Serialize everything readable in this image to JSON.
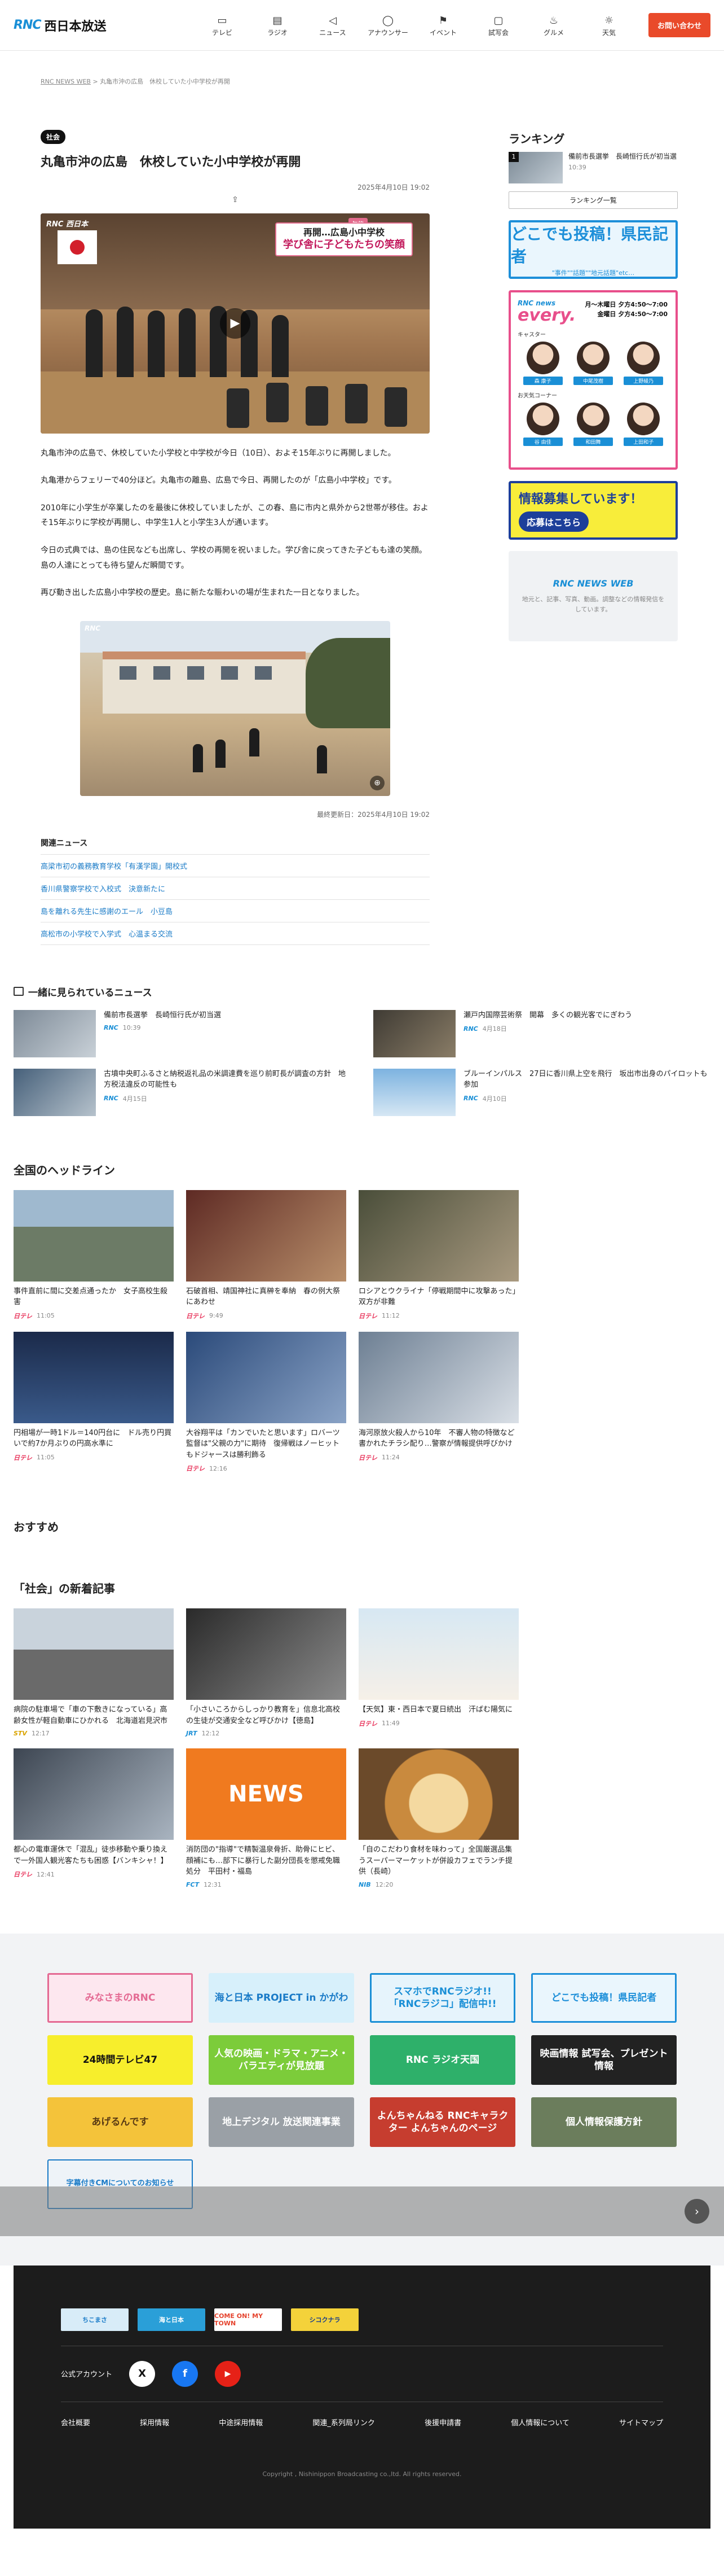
{
  "header": {
    "logo_mark": "RNC",
    "logo_text": "西日本放送",
    "nav": [
      {
        "icon": "tv-icon",
        "glyph": "▭",
        "label": "テレビ"
      },
      {
        "icon": "radio-icon",
        "glyph": "▤",
        "label": "ラジオ"
      },
      {
        "icon": "megaphone-icon",
        "glyph": "◁",
        "label": "ニュース"
      },
      {
        "icon": "person-icon",
        "glyph": "◯",
        "label": "アナウンサー"
      },
      {
        "icon": "flag-icon",
        "glyph": "⚑",
        "label": "イベント"
      },
      {
        "icon": "frame-icon",
        "glyph": "▢",
        "label": "試写会"
      },
      {
        "icon": "food-icon",
        "glyph": "♨",
        "label": "グルメ"
      },
      {
        "icon": "weather-icon",
        "glyph": "☼",
        "label": "天気"
      }
    ],
    "cta": "お問い合わせ"
  },
  "breadcrumb": {
    "home": "RNC NEWS WEB",
    "sep": ">",
    "current": "丸亀市沖の広島　休校していた小中学校が再開"
  },
  "article": {
    "tag": "社会",
    "title": "丸亀市沖の広島　休校していた小中学校が再開",
    "date": "2025年4月10日 19:02",
    "share_glyph": "⇪",
    "video": {
      "logo": "RNC 西日本",
      "badge": "午後",
      "telop_line1": "再開…広島小中学校",
      "telop_line2": "学び舎に子どもたちの笑顔",
      "play_glyph": "▶"
    },
    "paragraphs": [
      "丸亀市沖の広島で、休校していた小学校と中学校が今日（10日）、およそ15年ぶりに再開しました。",
      "丸亀港からフェリーで40分ほど。丸亀市の離島、広島で今日、再開したのが「広島小中学校」です。",
      "2010年に小学生が卒業したのを最後に休校していましたが、この春、島に市内と県外から2世帯が移住。およそ15年ぶりに学校が再開し、中学生1人と小学生3人が通います。",
      "今日の式典では、島の住民なども出席し、学校の再開を祝いました。学び舎に戻ってきた子どもも達の笑顔。島の人達にとっても待ち望んだ瞬間です。",
      "再び動き出した広島小中学校の歴史。島に新たな賑わいの場が生まれた一日となりました。"
    ],
    "photo_logo": "RNC",
    "zoom_glyph": "⊕",
    "updated": "最終更新日：2025年4月10日 19:02",
    "related_heading": "関連ニュース",
    "related": [
      "高梁市初の義務教育学校「有漢学園」開校式",
      "香川県警察学校で入校式　決意新たに",
      "島を離れる先生に感謝のエール　小豆島",
      "高松市の小学校で入学式　心温まる交流"
    ]
  },
  "sidebar": {
    "ranking_heading": "ランキング",
    "ranking": [
      {
        "num": "1",
        "title": "備前市長選挙　長崎恒行氏が初当選",
        "time": "10:39"
      }
    ],
    "ranking_button": "ランキング一覧",
    "banner_reporter": {
      "title": "どこでも投稿！県民記者",
      "sub": "\"事件\"\"話題\"\"地元話題\"etc…"
    },
    "banner_every": {
      "brand": "RNC news",
      "name": "every.",
      "times": [
        "月〜木曜日 夕方4:50〜7:00",
        "金曜日 夕方4:50〜7:00"
      ],
      "caster_label": "キャスター",
      "weather_label": "お天気コーナー",
      "casters": [
        "森 康子",
        "中尾茂樹",
        "上野綾乃"
      ],
      "weather": [
        "谷 由佳",
        "和田舞",
        "上田和子"
      ]
    },
    "banner_info": {
      "title": "情報募集しています！",
      "button": "応募はこちら"
    },
    "banner_ad": {
      "brand": "RNC NEWS WEB",
      "text": "地元と、記事、写真、動画。調整などの情報発信をしています。"
    }
  },
  "together": {
    "heading": "一緒に見られているニュース",
    "items": [
      {
        "title": "備前市長選挙　長崎恒行氏が初当選",
        "source": "RNC",
        "time": "10:39"
      },
      {
        "title": "瀬戸内国際芸術祭　開幕　多くの観光客でにぎわう",
        "source": "RNC",
        "time": "4月18日"
      },
      {
        "title": "古墳中央町ふるさと納税返礼品の米調達費を巡り前町長が調査の方針　地方税法違反の可能性も",
        "source": "RNC",
        "time": "4月15日"
      },
      {
        "title": "ブルーインパルス　27日に香川県上空を飛行　坂出市出身のパイロットも参加",
        "source": "RNC",
        "time": "4月10日"
      }
    ]
  },
  "national": {
    "heading": "全国のヘッドライン",
    "items": [
      {
        "title": "事件直前に間に交差点通ったか　女子高校生殺害",
        "source": "日テレ",
        "time": "11:05"
      },
      {
        "title": "石破首相、靖国神社に真榊を奉納　春の例大祭にあわせ",
        "source": "日テレ",
        "time": "9:49"
      },
      {
        "title": "ロシアとウクライナ「停戦期間中に攻撃あった」双方が非難",
        "source": "日テレ",
        "time": "11:12"
      },
      {
        "title": "円相場が一時1ドル＝140円台に　ドル売り円買いで約7か月ぶりの円高水準に",
        "source": "日テレ",
        "time": "11:05"
      },
      {
        "title": "大谷翔平は「カンでいたと思います」ロバーツ監督は\"父親の力\"に期待　復帰戦はノーヒットもドジャースは勝利飾る",
        "source": "日テレ",
        "time": "12:16"
      },
      {
        "title": "海河原放火殺人から10年　不審人物の特徴など書かれたチラシ配り…警察が情報提供呼びかけ",
        "source": "日テレ",
        "time": "11:24"
      }
    ]
  },
  "recommend": {
    "heading": "おすすめ"
  },
  "social": {
    "heading": "「社会」の新着記事",
    "items": [
      {
        "title": "病院の駐車場で「車の下敷きになっている」高齢女性が軽自動車にひかれる　北海道岩見沢市",
        "source": "STV",
        "time": "12:17"
      },
      {
        "title": "「小さいころからしっかり教育を」信息北高校の生徒が交通安全など呼びかけ【徳島】",
        "source": "JRT",
        "time": "12:12"
      },
      {
        "title": "【天気】東・西日本で夏日続出　汗ばむ陽気に",
        "source": "日テレ",
        "time": "11:49"
      },
      {
        "title": "都心の電車運休で「混乱」徒歩移動や乗り換えで一外国人観光客たちも困惑【バンキシャ！】",
        "source": "日テレ",
        "time": "12:41"
      },
      {
        "title": "消防団の\"指導\"で精製温泉骨折、助骨にヒビ、顔補にも…部下に暴行した副分団長を懲戒免職処分　平田村・福島",
        "source": "FCT",
        "time": "12:31"
      },
      {
        "title": "「自のこだわり食材を味わって」全国厳選品集うスーパーマーケットが併設カフェでランチ提供（長崎）",
        "source": "NIB",
        "time": "12:20"
      }
    ]
  },
  "bottom_banners": [
    {
      "name": "mina-banner",
      "text": "みなさまのRNC"
    },
    {
      "name": "sea-japan-banner",
      "text": "海と日本 PROJECT in かがわ"
    },
    {
      "name": "radiko-banner",
      "text": "スマホでRNCラジオ!! 「RNCラジコ」配信中!!"
    },
    {
      "name": "reporter-banner",
      "text": "どこでも投稿！県民記者"
    },
    {
      "name": "24h-tv-banner",
      "text": "24時間テレビ47"
    },
    {
      "name": "movie-drama-banner",
      "text": "人気の映画・ドラマ・アニメ・バラエティが見放題"
    },
    {
      "name": "radio-program-banner",
      "text": "RNC ラジオ天国"
    },
    {
      "name": "movie-info-banner",
      "text": "映画情報 試写会、プレゼント情報"
    },
    {
      "name": "agerundesu-banner",
      "text": "あげるんです"
    },
    {
      "name": "digital-banner",
      "text": "地上デジタル 放送関連事業"
    },
    {
      "name": "yonchan-banner",
      "text": "よんちゃんねる RNCキャラクター よんちゃんのページ"
    },
    {
      "name": "personal-info-banner",
      "text": "個人情報保護方針"
    },
    {
      "name": "cm-banner",
      "text": "字幕付きCMについてのお知らせ"
    }
  ],
  "scroll_button_glyph": "›",
  "footer": {
    "logos": [
      "ちこまさ",
      "海と日本",
      "COME ON! MY TOWN",
      "シコクナラ"
    ],
    "official_label": "公式アカウント",
    "social": [
      "X",
      "f",
      "▶"
    ],
    "links": [
      "会社概要",
      "採用情報",
      "中途採用情報",
      "関連_系列局リンク",
      "後援申請書",
      "個人情報について",
      "サイトマップ"
    ],
    "copyright": "Copyright , Nishinippon Broadcasting co.,ltd. All rights reserved."
  },
  "colors": {
    "accent": "#1a8fd6",
    "cta": "#e94a2a",
    "link": "#1a7bc7",
    "footer": "#1c1c1c"
  }
}
